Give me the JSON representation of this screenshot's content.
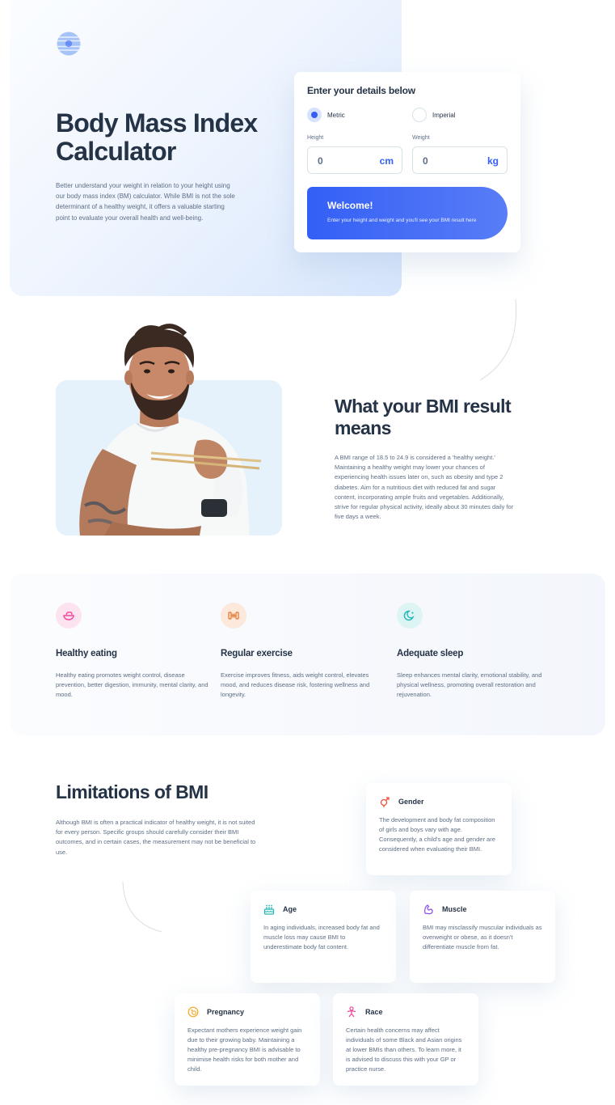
{
  "hero": {
    "logo_icon": "bmi-logo-icon",
    "title": "Body Mass Index Calculator",
    "description": "Better understand your weight in relation to your height using our body mass index (BM) calculator. While BMI is not the sole determinant of a healthy weight, it offers a valuable starting point to evaluate your overall health and well-being."
  },
  "calculator": {
    "heading": "Enter your details below",
    "units": [
      {
        "label": "Metric",
        "selected": true
      },
      {
        "label": "Imperial",
        "selected": false
      }
    ],
    "height": {
      "label": "Height",
      "value": "0",
      "unit": "cm"
    },
    "weight": {
      "label": "Weight",
      "value": "0",
      "unit": "kg"
    },
    "result": {
      "title": "Welcome!",
      "text": "Enter your height and weight and you'll see your BMI result here"
    }
  },
  "means": {
    "title": "What your BMI result means",
    "text": "A BMI range of 18.5 to 24.9 is considered a 'healthy weight.' Maintaining a healthy weight may lower your chances of experiencing health issues later on, such as obesity and type 2 diabetes. Aim for a nutritious diet with reduced fat and sugar content, incorporating ample fruits and vegetables. Additionally, strive for regular physical activity, ideally about 30 minutes daily for five days a week."
  },
  "tips": [
    {
      "icon": "bowl-icon",
      "title": "Healthy eating",
      "text": "Healthy eating promotes weight control, disease prevention, better digestion, immunity, mental clarity, and mood.",
      "color": "#f2449b",
      "bg": "#fde2ef"
    },
    {
      "icon": "dumbbell-icon",
      "title": "Regular exercise",
      "text": "Exercise improves fitness, aids weight control, elevates mood, and reduces disease risk, fostering wellness and longevity.",
      "color": "#e7803f",
      "bg": "#fde9db"
    },
    {
      "icon": "moon-icon",
      "title": "Adequate sleep",
      "text": "Sleep enhances mental clarity, emotional stability, and physical wellness, promoting overall restoration and rejuvenation.",
      "color": "#21b6b6",
      "bg": "#ddf4f4"
    }
  ],
  "limitations": {
    "title": "Limitations of BMI",
    "text": "Although BMI is often a practical indicator of healthy weight, it is not suited for every person. Specific groups should carefully consider their BMI outcomes, and in certain cases, the measurement may not be beneficial to use.",
    "cards": [
      {
        "icon": "gender-icon",
        "title": "Gender",
        "text": "The development and body fat composition of girls and boys vary with age. Consequently, a child's age and gender are considered when evaluating their BMI.",
        "color": "#f0503d"
      },
      {
        "icon": "birthday-cake-icon",
        "title": "Age",
        "text": "In aging individuals, increased body fat and muscle loss may cause BMI to underestimate body fat content.",
        "color": "#21b6b6"
      },
      {
        "icon": "muscle-icon",
        "title": "Muscle",
        "text": "BMI may misclassify muscular individuals as overweight or obese, as it doesn't differentiate muscle from fat.",
        "color": "#8a4af0"
      },
      {
        "icon": "pregnancy-icon",
        "title": "Pregnancy",
        "text": "Expectant mothers experience weight gain due to their growing baby. Maintaining a healthy pre-pregnancy BMI is advisable to minimise health risks for both mother and child.",
        "color": "#f5a623"
      },
      {
        "icon": "race-icon",
        "title": "Race",
        "text": "Certain health concerns may affect individuals of some Black and Asian origins at lower BMIs than others. To learn more, it is advised to discuss this with your GP or practice nurse.",
        "color": "#e8479a"
      }
    ]
  }
}
